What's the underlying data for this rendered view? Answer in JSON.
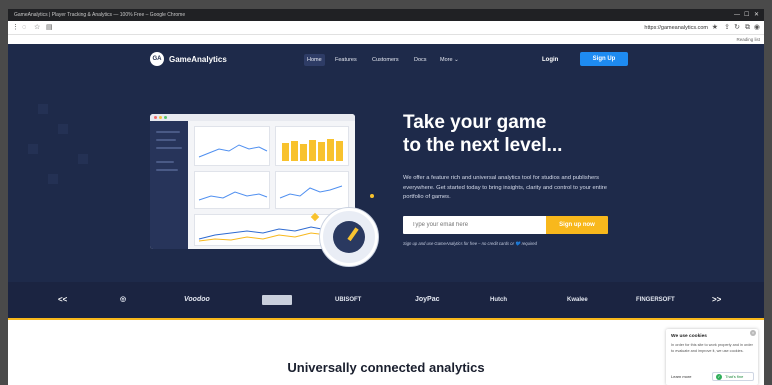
{
  "browser": {
    "window_title": "GameAnalytics | Player Tracking & Analytics — 100% Free – Google Chrome",
    "url": "https://gameanalytics.com",
    "reading_list_label": "Reading list",
    "nav_icons": [
      "back-icon",
      "reload-icon",
      "star-icon",
      "tab-search-icon"
    ]
  },
  "nav": {
    "logo_mark": "GA",
    "brand": "GameAnalytics",
    "items": [
      "Home",
      "Features",
      "Customers",
      "Docs",
      "More"
    ],
    "more_chevron": "⌄",
    "login": "Login",
    "signup": "Sign Up"
  },
  "hero": {
    "headline_line1": "Take your game",
    "headline_line2": "to the next level...",
    "subtext": "We offer a feature rich and universal analytics tool for studios and publishers everywhere. Get started today to bring insights, clarity and control to your entire portfolio of games.",
    "email_placeholder": "Type your email here",
    "cta": "Sign up now",
    "fine_print": "Sign up and use GameAnalytics for free – no credit cards or 💙 required"
  },
  "logos": {
    "prev": "<<",
    "next": ">>",
    "items": [
      "Voodoo",
      "UBISOFT",
      "JoyPac",
      "Hutch",
      "Kwalee",
      "FINGERSOFT"
    ]
  },
  "section": {
    "title": "Universally connected analytics"
  },
  "cookie": {
    "title": "We use cookies",
    "body": "In order for this site to work properly and in order to evaluate and improve it, we use cookies.",
    "learn_more": "Learn more",
    "accept": "That's fine",
    "close": "×"
  },
  "colors": {
    "hero_bg": "#1e2a4a",
    "accent_blue": "#1e8bf1",
    "accent_yellow": "#f8b81c"
  }
}
